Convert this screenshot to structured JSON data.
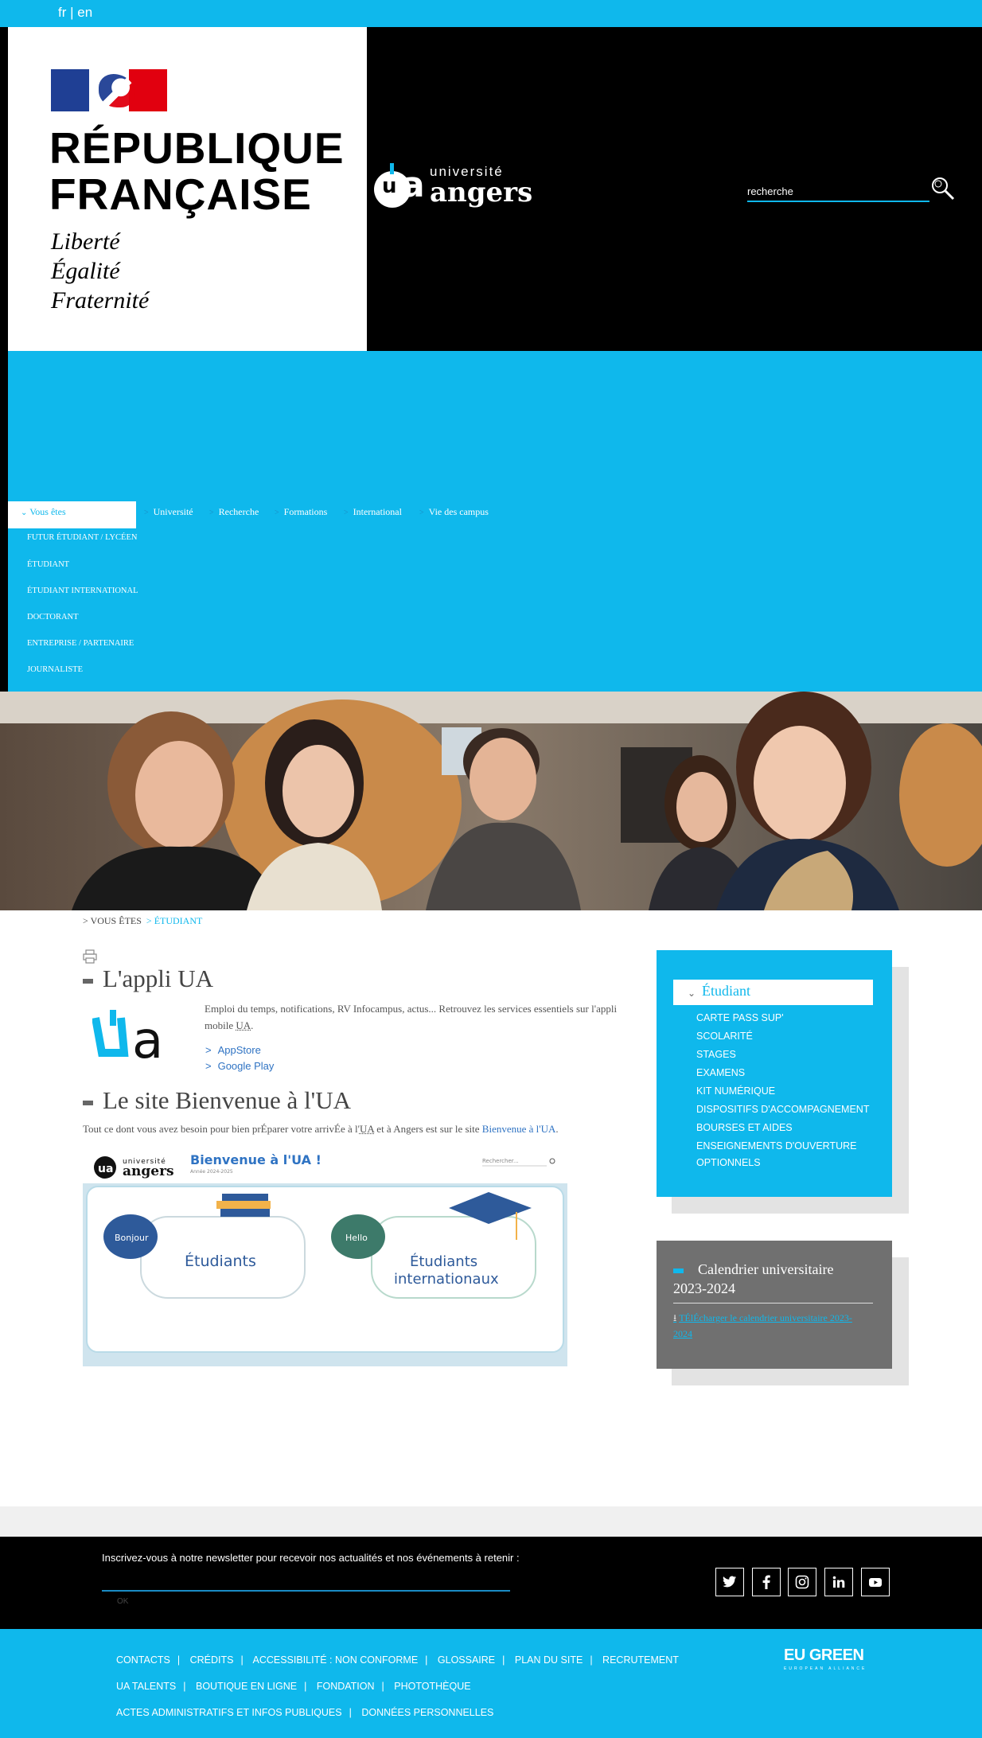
{
  "lang": {
    "fr": "fr",
    "separator": "|",
    "en": "en"
  },
  "rf": {
    "title_line1": "RÉPUBLIQUE",
    "title_line2": "FRANÇAISE",
    "motto": [
      "Liberté",
      "Égalité",
      "Fraternité"
    ]
  },
  "logo": {
    "line1": "université",
    "line2": "angers"
  },
  "search": {
    "placeholder": "recherche"
  },
  "menu": {
    "active": "Vous êtes",
    "items": [
      "Université",
      "Recherche",
      "Formations",
      "International",
      "Vie des campus"
    ],
    "submenu": [
      "FUTUR ÉTUDIANT / LYCÉEN",
      "ÉTUDIANT",
      "ÉTUDIANT INTERNATIONAL",
      "DOCTORANT",
      "ENTREPRISE / PARTENAIRE",
      "JOURNALISTE"
    ]
  },
  "breadcrumb": {
    "root": "VOUS ÊTES",
    "current": "ÉTUDIANT"
  },
  "app_section": {
    "title": "L'appli UA",
    "desc_part1": "Emploi du temps, notifications, RV Infocampus, actus... Retrouvez les services essentiels sur l'appli mobile ",
    "desc_ua": "UA",
    "desc_part2": ".",
    "links": [
      "AppStore",
      "Google Play"
    ]
  },
  "welcome_section": {
    "title": "Le site Bienvenue à l'UA",
    "intro_part1": "Tout ce dont vous avez besoin pour bien prÉparer votre arrivÉe à l'",
    "intro_ua": "UA",
    "intro_part2": " et à Angers est sur le site ",
    "intro_link": "Bienvenue à l'UA",
    "intro_part3": ".",
    "banner": {
      "logo_line1": "université",
      "logo_line2": "angers",
      "title": "Bienvenue à l'UA !",
      "subtitle": "Année 2024-2025",
      "search_placeholder": "Rechercher...",
      "bubble1": "Bonjour",
      "card1": "Étudiants",
      "bubble2": "Hello",
      "card2_line1": "Étudiants",
      "card2_line2": "internationaux"
    }
  },
  "sidebar": {
    "heading": "Étudiant",
    "items": [
      "CARTE PASS SUP'",
      "SCOLARITÉ",
      "STAGES",
      "EXAMENS",
      "KIT NUMÉRIQUE",
      "DISPOSITIFS D'ACCOMPAGNEMENT",
      "BOURSES ET AIDES",
      "ENSEIGNEMENTS D'OUVERTURE",
      "OPTIONNELS"
    ]
  },
  "calendar": {
    "title_line1": "Calendrier universitaire",
    "title_line2": "2023-2024",
    "link_line1": "TÉlÉcharger le calendrier universitaire 2023-",
    "link_line2": "2024"
  },
  "newsletter": {
    "text": "Inscrivez-vous à notre newsletter pour recevoir nos actualités et nos événements à retenir :",
    "button": "OK"
  },
  "social": [
    "twitter-icon",
    "facebook-icon",
    "instagram-icon",
    "linkedin-icon",
    "youtube-icon"
  ],
  "footer": {
    "row1": [
      "Contacts",
      "Crédits",
      "Accessibilité : non conforme",
      "Glossaire",
      "Plan du site",
      "Recrutement"
    ],
    "row2": [
      "UA Talents",
      "Boutique en ligne",
      "Fondation",
      "Photothèque"
    ],
    "row3": [
      "Actes administratifs et infos publiques",
      "Données personnelles"
    ],
    "separator": "|",
    "eugreen": "EU GREEN",
    "eugreen_sub": "EUROPEAN ALLIANCE"
  },
  "colors": {
    "accent": "#0fb8ec",
    "dark": "#000000",
    "panel": "#707070"
  }
}
